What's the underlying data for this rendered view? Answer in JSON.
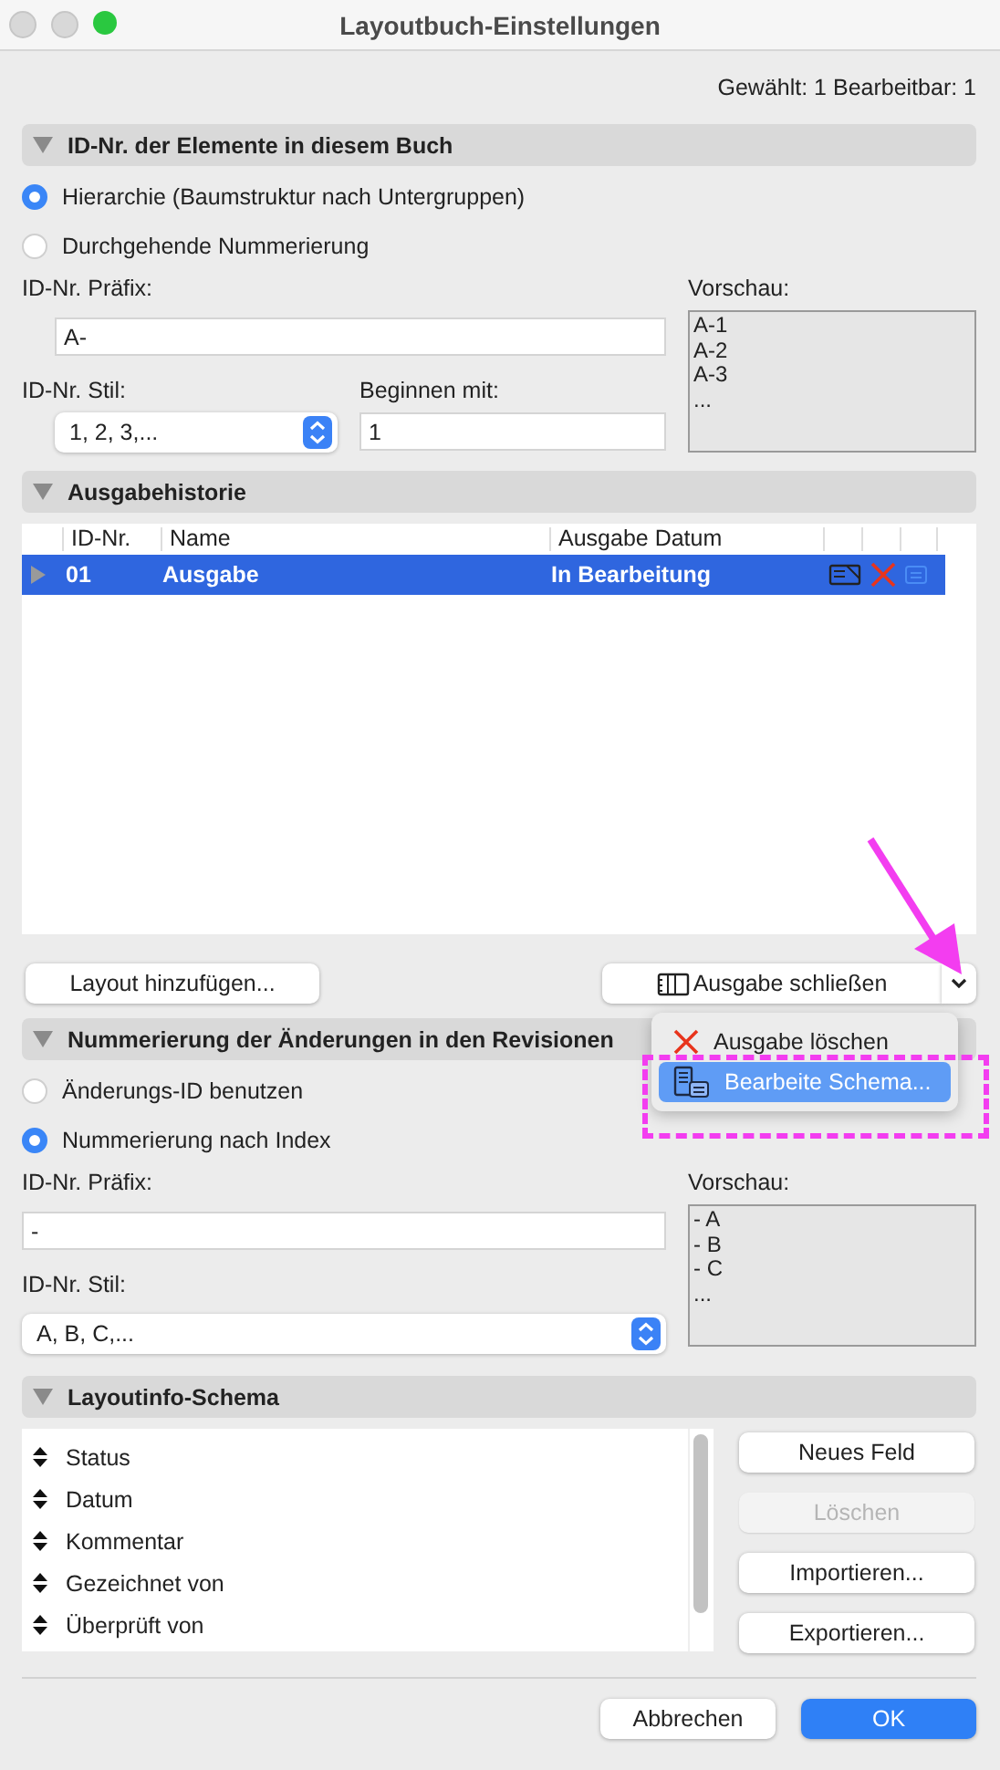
{
  "window": {
    "title": "Layoutbuch-Einstellungen"
  },
  "selection_info": "Gewählt: 1 Bearbeitbar: 1",
  "id_section": {
    "title": "ID-Nr. der Elemente in diesem Buch",
    "expanded": true,
    "options": [
      {
        "label": "Hierarchie (Baumstruktur nach Untergruppen)",
        "selected": true
      },
      {
        "label": "Durchgehende Nummerierung",
        "selected": false
      }
    ],
    "prefix_label": "ID-Nr. Präfix:",
    "prefix_value": "A-",
    "preview_label": "Vorschau:",
    "preview_lines": [
      "A-1",
      "A-2",
      "A-3",
      "..."
    ],
    "style_label": "ID-Nr. Stil:",
    "style_value": "1, 2, 3,...",
    "start_label": "Beginnen mit:",
    "start_value": "1"
  },
  "history_section": {
    "title": "Ausgabehistorie",
    "expanded": true,
    "columns": [
      "ID-Nr.",
      "Name",
      "Ausgabe Datum"
    ],
    "rows": [
      {
        "id": "01",
        "name": "Ausgabe",
        "date": "In Bearbeitung",
        "selected": true,
        "expanded": false
      }
    ],
    "add_button": "Layout hinzufügen...",
    "split_button": "Ausgabe schließen",
    "menu_items": [
      {
        "kind": "delete",
        "label": "Ausgabe löschen",
        "selected": false
      },
      {
        "kind": "schema",
        "label": "Bearbeite Schema...",
        "selected": true
      }
    ]
  },
  "revision_section": {
    "title": "Nummerierung der Änderungen in den Revisionen",
    "expanded": true,
    "options": [
      {
        "label": "Änderungs-ID benutzen",
        "selected": false
      },
      {
        "label": "Nummerierung nach Index",
        "selected": true
      }
    ],
    "prefix_label": "ID-Nr. Präfix:",
    "prefix_value": "-",
    "preview_label": "Vorschau:",
    "preview_lines": [
      "- A",
      "- B",
      "- C",
      "..."
    ],
    "style_label": "ID-Nr. Stil:",
    "style_value": "A, B, C,..."
  },
  "schema_section": {
    "title": "Layoutinfo-Schema",
    "expanded": true,
    "fields": [
      "Status",
      "Datum",
      "Kommentar",
      "Gezeichnet von",
      "Überprüft von"
    ],
    "buttons": [
      {
        "label": "Neues Feld",
        "disabled": false
      },
      {
        "label": "Löschen",
        "disabled": true
      },
      {
        "label": "Importieren...",
        "disabled": false
      },
      {
        "label": "Exportieren...",
        "disabled": false
      }
    ]
  },
  "footer_buttons": [
    {
      "kind": "cancel",
      "label": "Abbrechen"
    },
    {
      "kind": "default",
      "label": "OK"
    }
  ]
}
